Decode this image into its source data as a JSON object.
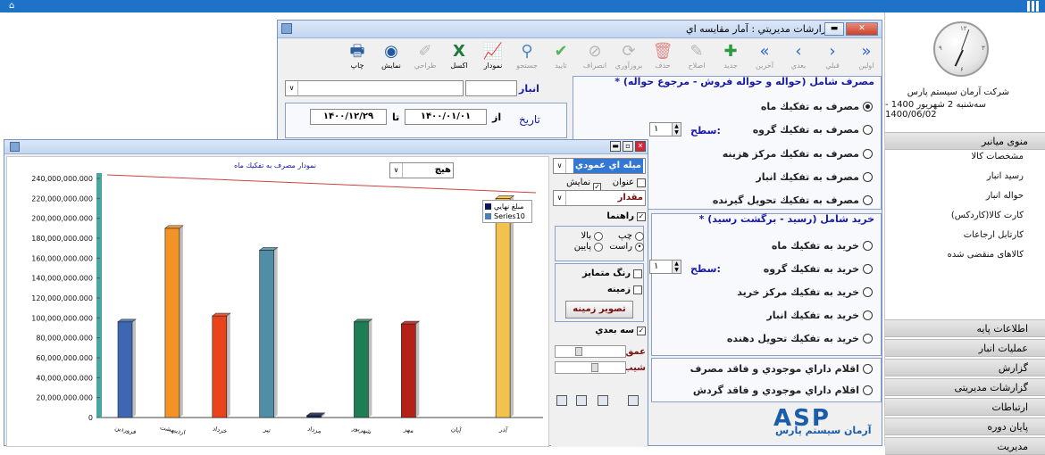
{
  "colors": {
    "topbar": "#1e73c8",
    "accent": "#1a1aa8",
    "legend_final": "#0b1a5a",
    "legend_series10": "#4a7fb3"
  },
  "rightpanel": {
    "company": "شرکت آرمان سیستم پارس",
    "date_text": "سه‌شنبه 2 شهریور 1400 - 1400/06/02",
    "menu_title": "منوی میانبر",
    "menu_items": [
      "مشخصات کالا",
      "رسید انبار",
      "حواله انبار",
      "کارت کالا(کاردکس)",
      "کارتابل ارجاعات",
      "کالاهای منقضی شده"
    ],
    "sections": [
      "اطلاعات پایه",
      "عملیات انبار",
      "گزارش",
      "گزارشات مدیریتی",
      "ارتباطات",
      "پایان دوره",
      "مدیریت"
    ]
  },
  "mgr": {
    "title": "گزارشات مديريتي : آمار مقايسه اي",
    "toolbar": [
      {
        "label": "اولين",
        "icon": "first-icon",
        "disabled": true
      },
      {
        "label": "قبلي",
        "icon": "prev-icon",
        "disabled": true
      },
      {
        "label": "بعدي",
        "icon": "next-icon",
        "disabled": true
      },
      {
        "label": "آخرين",
        "icon": "last-icon",
        "disabled": true
      },
      {
        "label": "جديد",
        "icon": "add-icon",
        "disabled": true
      },
      {
        "label": "اصلاح",
        "icon": "edit-icon",
        "disabled": true
      },
      {
        "label": "حذف",
        "icon": "delete-icon",
        "disabled": true
      },
      {
        "label": "بروزآوري",
        "icon": "refresh-icon",
        "disabled": true
      },
      {
        "label": "انصراف",
        "icon": "cancel-icon",
        "disabled": true
      },
      {
        "label": "تاييد",
        "icon": "confirm-icon",
        "disabled": true
      },
      {
        "label": "جستجو",
        "icon": "search-icon",
        "disabled": true
      },
      {
        "label": "نمودار",
        "icon": "chart-icon",
        "disabled": false
      },
      {
        "label": "اكسل",
        "icon": "excel-icon",
        "disabled": false
      },
      {
        "label": "طراحي",
        "icon": "design-icon",
        "disabled": true
      },
      {
        "label": "نمايش",
        "icon": "view-icon",
        "disabled": false
      },
      {
        "label": "چاپ",
        "icon": "print-icon",
        "disabled": false
      }
    ],
    "store_label": "انبار",
    "date_label": "تاريخ",
    "from_label": "از",
    "to_label": "تا",
    "date_from": "۱۴۰۰/۰۱/۰۱",
    "date_to": "۱۴۰۰/۱۲/۲۹",
    "group1_title": "* مصرف شامل (حواله و حواله فروش - مرجوع حواله)",
    "group1_options": [
      "مصرف به تفكيك ماه",
      "مصرف به تفكيك گروه",
      "مصرف به تفكيك مركز هزينه",
      "مصرف به تفكيك انبار",
      "مصرف به تفكيك تحويل گيرنده"
    ],
    "level_label": "سطح:",
    "level_value": "۱",
    "group2_title": "* خريد شامل (رسيد - برگشت رسيد)",
    "group2_options": [
      "خريد به تفكيك ماه",
      "خريد به تفكيك گروه",
      "خريد به تفكيك مركز خريد",
      "خريد به تفكيك انبار",
      "خريد به تفكيك تحويل دهنده"
    ],
    "group3_options": [
      "اقلام داراي موجودي و فاقد مصرف",
      "اقلام داراي موجودي و فاقد گردش"
    ]
  },
  "brand": {
    "logo": "ASP",
    "name": "آرمان سیستم پارس"
  },
  "chartpanel": {
    "chart_type_value": "ميله اي عمودي",
    "title_check": "عنوان",
    "axis_check": "نمايش محور",
    "value_combo": "مقدار",
    "guide_check": "راهنما",
    "pos_left": "چپ",
    "pos_right": "راست",
    "pos_top": "بالا",
    "pos_bottom": "پايين",
    "varied_color": "رنگ متمايز",
    "background": "زمينه",
    "bg_image_btn": "تصوير زمينه",
    "threed": "سه بعدي",
    "depth": "عمق",
    "slope": "شيب",
    "palette_value": "هيچ"
  },
  "chart_data": {
    "type": "bar",
    "title": "نمودار مصرف به تفكيك ماه",
    "categories": [
      "فروردين",
      "ارديبهشت",
      "خرداد",
      "تير",
      "مرداد",
      "شهريور",
      "مهر",
      "آبان",
      "آذر"
    ],
    "values": [
      96000000,
      190000000,
      102000000,
      168000000,
      2000000,
      96000000,
      94000000,
      0,
      220000000
    ],
    "colors": [
      "#3d67b0",
      "#f39325",
      "#e8431b",
      "#4f8ea6",
      "#14204f",
      "#1f7d55",
      "#b52018",
      "#888888",
      "#f2c14e"
    ],
    "ylim": [
      0,
      240000000
    ],
    "ytick_labels": [
      "0",
      "20,000,000.000",
      "40,000,000.000",
      "60,000,000.000",
      "80,000,000.000",
      "100,000,000.000",
      "120,000,000.000",
      "140,000,000.000",
      "160,000,000.000",
      "180,000,000.000",
      "200,000,000.000",
      "220,000,000.000",
      "240,000,000.000"
    ],
    "legend": [
      "مبلغ نهايي",
      "Series10"
    ],
    "grid": false,
    "legend_position": "top-right"
  }
}
